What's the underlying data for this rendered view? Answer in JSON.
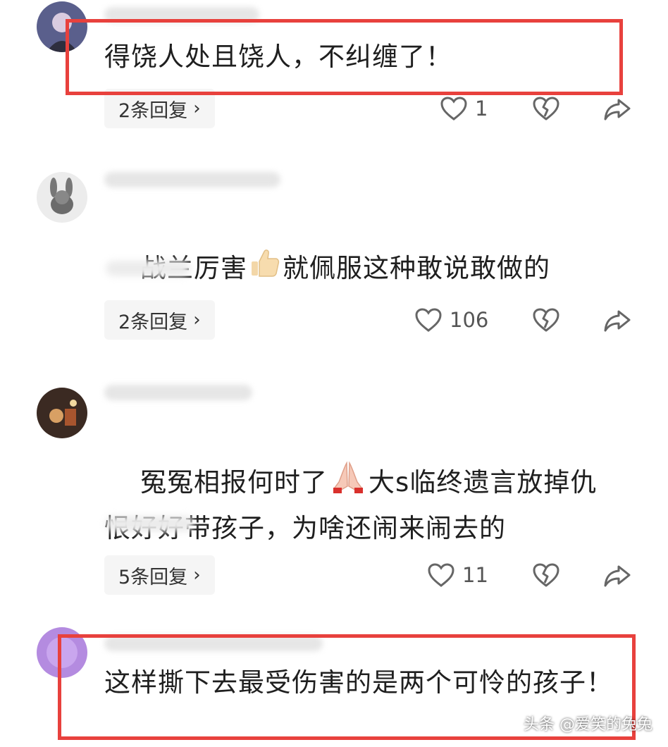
{
  "comments": [
    {
      "text": "得饶人处且饶人，不纠缠了！",
      "replies": "2条回复",
      "likes": "1"
    },
    {
      "text_before": "战兰厉害",
      "emoji": "thumbs-up-icon",
      "text_after": "就佩服这种敢说敢做的",
      "replies": "2条回复",
      "likes": "106"
    },
    {
      "text_before": "冤冤相报何时了",
      "emoji": "praying-hands-icon",
      "text_after": "大s临终遗言放掉仇恨好好带孩子，为啥还闹来闹去的",
      "replies": "5条回复",
      "likes": "11"
    },
    {
      "text": "这样撕下去最受伤害的是两个可怜的孩子！"
    }
  ],
  "icons": {
    "like": "heart-outline-icon",
    "dislike": "broken-heart-icon",
    "share": "share-arrow-icon",
    "chevron": "chevron-right-icon"
  },
  "colors": {
    "highlight": "#e8413d",
    "pill_bg": "#f5f5f5"
  },
  "watermark": "头条 @爱笑的兔兔"
}
